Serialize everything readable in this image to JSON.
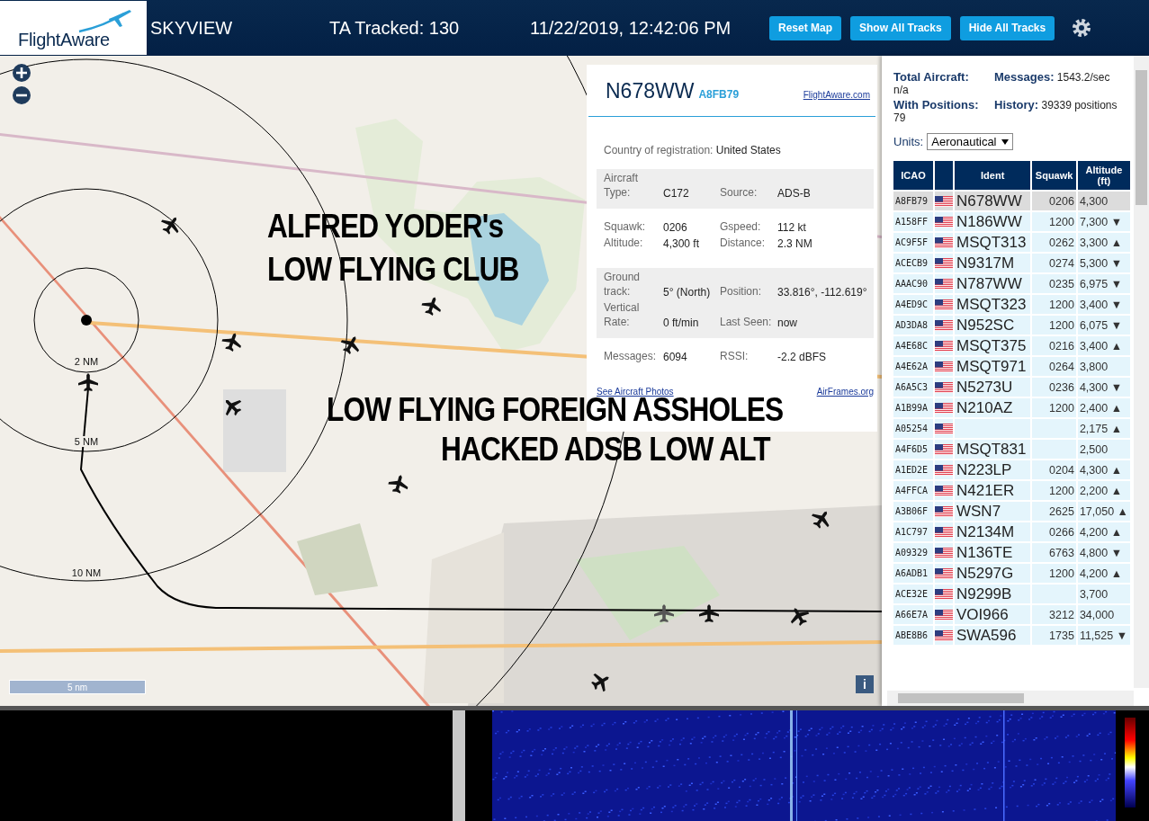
{
  "header": {
    "logo": "FlightAware",
    "title": "SKYVIEW",
    "tracked": "TA Tracked: 130",
    "datetime": "11/22/2019, 12:42:06 PM",
    "buttons": [
      "Reset Map",
      "Show All Tracks",
      "Hide All Tracks"
    ]
  },
  "map": {
    "kind": "picture",
    "range_rings": [
      "2 NM",
      "5 NM",
      "10 NM"
    ],
    "scale": "5 nm",
    "info_button": "i",
    "annotations": [
      "ALFRED YODER's",
      "LOW FLYING CLUB",
      "LOW FLYING FOREIGN ASSHOLES",
      "HACKED ADSB LOW ALT"
    ]
  },
  "popup": {
    "ident": "N678WW",
    "icao": "A8FB79",
    "link": "FlightAware.com",
    "country_label": "Country of registration:",
    "country": "United States",
    "sections": [
      {
        "shaded": true,
        "fields": [
          {
            "label": "Aircraft Type:",
            "value": "C172"
          },
          {
            "label": "Source:",
            "value": "ADS-B"
          }
        ]
      },
      {
        "shaded": false,
        "fields": [
          {
            "label": "Squawk:",
            "value": "0206"
          },
          {
            "label": "Gspeed:",
            "value": "112 kt"
          },
          {
            "label": "Altitude:",
            "value": "4,300 ft"
          },
          {
            "label": "Distance:",
            "value": "2.3 NM"
          }
        ]
      },
      {
        "shaded": true,
        "fields": [
          {
            "label": "Ground track:",
            "value": "5° (North)"
          },
          {
            "label": "Position:",
            "value": "33.816°, -112.619°"
          },
          {
            "label": "Vertical Rate:",
            "value": "0 ft/min"
          },
          {
            "label": "Last Seen:",
            "value": "now"
          }
        ]
      },
      {
        "shaded": false,
        "fields": [
          {
            "label": "Messages:",
            "value": "6094"
          },
          {
            "label": "RSSI:",
            "value": "-2.2 dBFS"
          }
        ]
      }
    ],
    "links": [
      "See Aircraft Photos",
      "AirFrames.org"
    ]
  },
  "stats": [
    {
      "label": "Total Aircraft:",
      "value": "n/a"
    },
    {
      "label": "Messages:",
      "value": "1543.2/sec"
    },
    {
      "label": "With Positions:",
      "value": "79"
    },
    {
      "label": "History:",
      "value": "39339 positions"
    }
  ],
  "units": {
    "label": "Units:",
    "value": "Aeronautical"
  },
  "table": {
    "columns": [
      "ICAO",
      "Ident",
      "Squawk",
      "Altitude (ft)"
    ],
    "rows": [
      {
        "icao": "A8FB79",
        "ident": "N678WW",
        "squawk": "0206",
        "altitude": "4,300",
        "selected": true
      },
      {
        "icao": "A158FF",
        "ident": "N186WW",
        "squawk": "1200",
        "altitude": "7,300",
        "trend": "▼",
        "selected": false
      },
      {
        "icao": "AC9F5F",
        "ident": "MSQT313",
        "squawk": "0262",
        "altitude": "3,300",
        "trend": "▲",
        "selected": false
      },
      {
        "icao": "ACECB9",
        "ident": "N9317M",
        "squawk": "0274",
        "altitude": "5,300",
        "trend": "▼",
        "selected": false
      },
      {
        "icao": "AAAC90",
        "ident": "N787WW",
        "squawk": "0235",
        "altitude": "6,975",
        "trend": "▼",
        "selected": false
      },
      {
        "icao": "A4ED9C",
        "ident": "MSQT323",
        "squawk": "1200",
        "altitude": "3,400",
        "trend": "▼",
        "selected": false
      },
      {
        "icao": "AD3DA8",
        "ident": "N952SC",
        "squawk": "1200",
        "altitude": "6,075",
        "trend": "▼",
        "selected": false
      },
      {
        "icao": "A4E68C",
        "ident": "MSQT375",
        "squawk": "0216",
        "altitude": "3,400",
        "trend": "▲",
        "selected": false
      },
      {
        "icao": "A4E62A",
        "ident": "MSQT971",
        "squawk": "0264",
        "altitude": "3,800",
        "selected": false
      },
      {
        "icao": "A6A5C3",
        "ident": "N5273U",
        "squawk": "0236",
        "altitude": "4,300",
        "trend": "▼",
        "selected": false
      },
      {
        "icao": "A1B99A",
        "ident": "N210AZ",
        "squawk": "1200",
        "altitude": "2,400",
        "trend": "▲",
        "selected": false
      },
      {
        "icao": "A05254",
        "altitude": "2,175",
        "trend": "▲",
        "selected": false
      },
      {
        "icao": "A4F6D5",
        "ident": "MSQT831",
        "altitude": "2,500",
        "selected": false
      },
      {
        "icao": "A1ED2E",
        "ident": "N223LP",
        "squawk": "0204",
        "altitude": "4,300",
        "trend": "▲",
        "selected": false
      },
      {
        "icao": "A4FFCA",
        "ident": "N421ER",
        "squawk": "1200",
        "altitude": "2,200",
        "trend": "▲",
        "selected": false
      },
      {
        "icao": "A3B06F",
        "ident": "WSN7",
        "squawk": "2625",
        "altitude": "17,050",
        "trend": "▲",
        "selected": false
      },
      {
        "icao": "A1C797",
        "ident": "N2134M",
        "squawk": "0266",
        "altitude": "4,200",
        "trend": "▲",
        "selected": false
      },
      {
        "icao": "A09329",
        "ident": "N136TE",
        "squawk": "6763",
        "altitude": "4,800",
        "trend": "▼",
        "selected": false
      },
      {
        "icao": "A6ADB1",
        "ident": "N5297G",
        "squawk": "1200",
        "altitude": "4,200",
        "trend": "▲",
        "selected": false
      },
      {
        "icao": "ACE32E",
        "ident": "N9299B",
        "altitude": "3,700",
        "selected": false
      },
      {
        "icao": "A66E7A",
        "ident": "VOI966",
        "squawk": "3212",
        "altitude": "34,000",
        "selected": false
      },
      {
        "icao": "ABE8B6",
        "ident": "SWA596",
        "squawk": "1735",
        "altitude": "11,525",
        "trend": "▼",
        "selected": false
      }
    ]
  }
}
